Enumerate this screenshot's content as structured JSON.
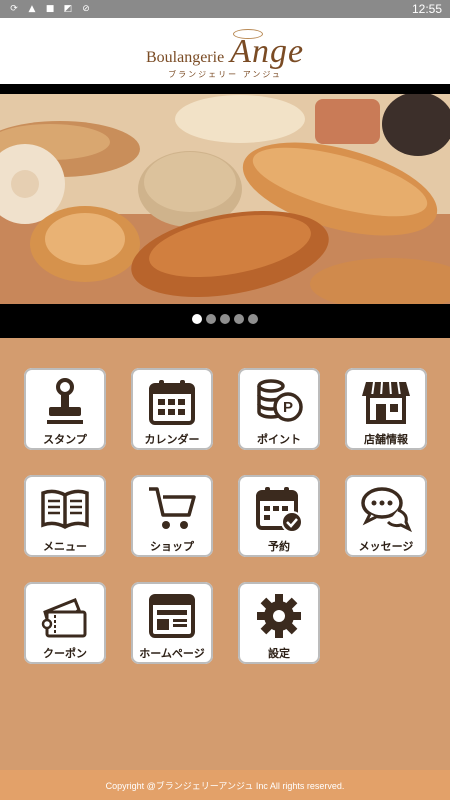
{
  "status_bar": {
    "time": "12:55"
  },
  "header": {
    "logo_prefix": "Boulangerie",
    "logo_name": "Ange",
    "logo_subtitle": "ブランジェリー アンジュ"
  },
  "banner": {
    "slides": 5,
    "active_slide": 1
  },
  "menu": {
    "items": [
      {
        "label": "スタンプ",
        "icon": "stamp-icon"
      },
      {
        "label": "カレンダー",
        "icon": "calendar-icon"
      },
      {
        "label": "ポイント",
        "icon": "points-coins-icon"
      },
      {
        "label": "店舗情報",
        "icon": "store-icon"
      },
      {
        "label": "メニュー",
        "icon": "book-icon"
      },
      {
        "label": "ショップ",
        "icon": "cart-icon"
      },
      {
        "label": "予約",
        "icon": "calendar-check-icon"
      },
      {
        "label": "メッセージ",
        "icon": "chat-bubbles-icon"
      },
      {
        "label": "クーポン",
        "icon": "coupon-icon"
      },
      {
        "label": "ホームページ",
        "icon": "browser-icon"
      },
      {
        "label": "設定",
        "icon": "gear-icon"
      }
    ]
  },
  "footer": {
    "copyright": "Copyright @ブランジェリーアンジュ Inc All rights reserved."
  },
  "colors": {
    "background": "#d39c6f",
    "footer": "#e3a169",
    "icon": "#3b2a1e",
    "logo": "#7a4b24"
  }
}
